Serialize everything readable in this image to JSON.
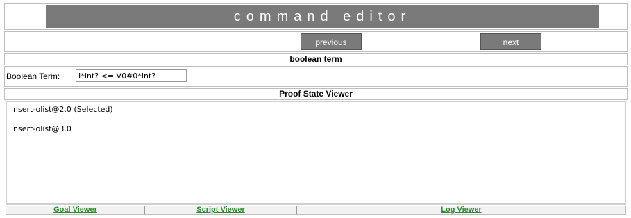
{
  "header": {
    "title": "command editor"
  },
  "nav": {
    "previous_label": "previous",
    "next_label": "next"
  },
  "boolean_section": {
    "header": "boolean term",
    "field_label": "Boolean Term:",
    "field_value": "I*Int? <= V0#0*Int?"
  },
  "proof_state": {
    "header": "Proof State Viewer",
    "items": [
      {
        "label": "insert-olist@2.0 (Selected)"
      },
      {
        "label": "insert-olist@3.0"
      }
    ]
  },
  "tabs": {
    "goal_viewer": "Goal Viewer",
    "script_viewer": "Script Viewer",
    "log_viewer": "Log Viewer"
  },
  "colors": {
    "title_bar_bg": "#7a7a7a",
    "link_green": "#2e8b2e",
    "border_gray": "#bdbdbd"
  }
}
